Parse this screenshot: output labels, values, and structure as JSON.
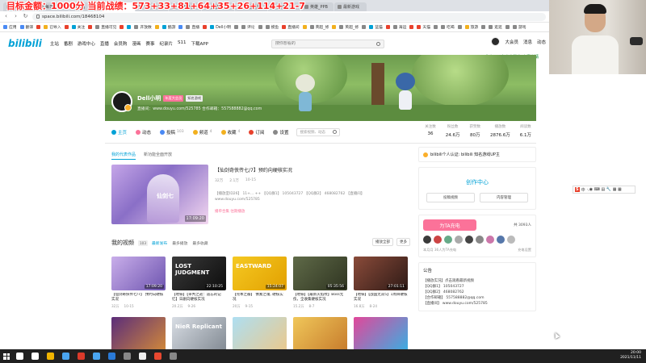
{
  "overlay": {
    "banner": "目标金额：1000分   当前战绩：573+33+81+64+35+26+114+21-7"
  },
  "tabs": [
    {
      "label": "全民超神",
      "active": false
    },
    {
      "label": "每日",
      "active": false
    },
    {
      "label": "B站",
      "active": false
    },
    {
      "label": "主页",
      "active": true
    },
    {
      "label": "创作中心",
      "active": false
    },
    {
      "label": "创作中心",
      "active": false
    },
    {
      "label": "蓝猫新闻",
      "active": false
    },
    {
      "label": "蓝猫新闻",
      "active": false
    },
    {
      "label": "多开",
      "active": false
    },
    {
      "label": "英雄_PPB",
      "active": false
    },
    {
      "label": "最新游戏",
      "active": false
    }
  ],
  "address": {
    "url": "space.bilibili.com/18468104"
  },
  "bookmarks": [
    {
      "label": "应用",
      "color": "#4a8af4"
    },
    {
      "label": "翻译",
      "color": "#4a8af4"
    },
    {
      "label": "",
      "color": "#e8412c"
    },
    {
      "label": "已导入",
      "color": "#f2b01e"
    },
    {
      "label": "",
      "color": "#e8412c"
    },
    {
      "label": "关注",
      "color": "#00a1d6"
    },
    {
      "label": "",
      "color": "#e8412c"
    },
    {
      "label": "直播可见",
      "color": "#888"
    },
    {
      "label": "",
      "color": "#e8412c"
    },
    {
      "label": "",
      "color": "#00a1d6"
    },
    {
      "label": "开放数",
      "color": "#888"
    },
    {
      "label": "",
      "color": "#f2b01e"
    },
    {
      "label": "酷游",
      "color": "#00a1d6"
    },
    {
      "label": "",
      "color": "#4a8af4"
    },
    {
      "label": "直播",
      "color": "#888"
    },
    {
      "label": "",
      "color": "#e8412c"
    },
    {
      "label": "Dell小明",
      "color": "#00a1d6"
    },
    {
      "label": "",
      "color": "#888"
    },
    {
      "label": "评论",
      "color": "#888"
    },
    {
      "label": "",
      "color": "#888"
    },
    {
      "label": "摸鱼",
      "color": "#888"
    },
    {
      "label": "直播间",
      "color": "#e8412c"
    },
    {
      "label": "",
      "color": "#f2b01e"
    },
    {
      "label": "英超_修",
      "color": "#888"
    },
    {
      "label": "",
      "color": "#f2b01e"
    },
    {
      "label": "英超_修",
      "color": "#888"
    },
    {
      "label": "",
      "color": "#888"
    },
    {
      "label": "蓝猫",
      "color": "#00a1d6"
    },
    {
      "label": "",
      "color": "#e8412c"
    },
    {
      "label": "海运",
      "color": "#888"
    },
    {
      "label": "",
      "color": "#e8412c"
    },
    {
      "label": "天猫",
      "color": "#e8412c"
    },
    {
      "label": "",
      "color": "#888"
    },
    {
      "label": "吃喝",
      "color": "#888"
    },
    {
      "label": "",
      "color": "#888"
    },
    {
      "label": "旅游",
      "color": "#f2b01e"
    },
    {
      "label": "",
      "color": "#888"
    },
    {
      "label": "逛逛",
      "color": "#888"
    },
    {
      "label": "",
      "color": "#888"
    },
    {
      "label": "游戏",
      "color": "#888"
    }
  ],
  "header": {
    "logo": "bilibili",
    "nav": [
      "主站",
      "番剧",
      "游戏中心",
      "直播",
      "会员购",
      "漫画",
      "赛事",
      "纪录片",
      "S11",
      "下载APP"
    ],
    "search_placeholder": "搜你想看的",
    "right": [
      "大会员",
      "消息",
      "动态"
    ]
  },
  "notice": "你有780条充电消息 查看详情",
  "profile": {
    "name": "Dell小明",
    "badge1": "年度大会员",
    "badge2": "知名游戏",
    "sign": "直播间：www.douyu.com/525785 合作邮箱：557588882@qq.com"
  },
  "page_nav": {
    "items": [
      {
        "label": "主页",
        "count": "",
        "active": true,
        "color": "#00a1d6"
      },
      {
        "label": "动态",
        "count": "",
        "active": false,
        "color": "#fb7299"
      },
      {
        "label": "投稿",
        "count": "103",
        "active": false,
        "color": "#4a8af4"
      },
      {
        "label": "频道",
        "count": "4",
        "active": false,
        "color": "#f2b01e"
      },
      {
        "label": "收藏",
        "count": "4",
        "active": false,
        "color": "#f2b01e"
      },
      {
        "label": "订阅",
        "count": "",
        "active": false,
        "color": "#e8412c"
      },
      {
        "label": "设置",
        "count": "",
        "active": false,
        "color": "#888"
      }
    ],
    "search_placeholder": "搜索视频、动态"
  },
  "stats": [
    {
      "label": "关注数",
      "value": "36"
    },
    {
      "label": "粉丝数",
      "value": "24.6万"
    },
    {
      "label": "获赞数",
      "value": "80万"
    },
    {
      "label": "播放数",
      "value": "2876.6万"
    },
    {
      "label": "阅读数",
      "value": "6.1万"
    }
  ],
  "representative": {
    "tabs": [
      {
        "label": "我的代表作品",
        "active": true
      },
      {
        "label": "新功能全面开放",
        "active": false
      }
    ],
    "title": "【仙剑奇侠传七/7】预约向硬核实况",
    "duration": "17:09:20",
    "meta": [
      "32万",
      "2.1万",
      "10-15"
    ],
    "desc": "【播放室ID26】 11+... ++ 【QQ群1】 105043727 【QQ群2】 468082762 【直播间】 www.douyu.com/525785",
    "links": "播单合集  往期播放"
  },
  "videos_header": {
    "title": "我的视频",
    "count": "103",
    "sorts": [
      {
        "label": "最新发布",
        "active": true
      },
      {
        "label": "最多播放",
        "active": false
      },
      {
        "label": "最多收藏",
        "active": false
      }
    ],
    "btn_play": "播放全部",
    "btn_more": "更多"
  },
  "videos": [
    {
      "title": "【仙剑奇侠传七/7】 预约向硬核实况",
      "duration": "17:09:20",
      "plays": "32万",
      "date": "10-15",
      "tt": "",
      "c1": "#c9aeea",
      "c2": "#6e55b0"
    },
    {
      "title": "【地铁】【审判之逝：遗忘的记忆】日剧向硬核实况",
      "duration": "22:10:25",
      "plays": "20.2万",
      "date": "9-26",
      "tt": "LOST JUDGMENT",
      "c1": "#3a3a3a",
      "c2": "#0d0d0d"
    },
    {
      "title": "【完本之瓣】 像素之魂, 硬核实况",
      "duration": "15:24:07",
      "plays": "20万",
      "date": "9-15",
      "tt": "EASTWARD",
      "c1": "#f5c922",
      "c2": "#e2a000"
    },
    {
      "title": "【地铁】【最新火焰纹】Boss无伤，全收集硬核实况",
      "duration": "05:35:56",
      "plays": "15.2万",
      "date": "8-7",
      "tt": "",
      "c1": "#5f6a48",
      "c2": "#2f3421"
    },
    {
      "title": "【地铁】【战国无双5】1周目硬核实况",
      "duration": "27:01:11",
      "plays": "16.8万",
      "date": "8-24",
      "tt": "",
      "c1": "#8a4b3a",
      "c2": "#2e1a16"
    },
    {
      "title": "",
      "duration": "",
      "plays": "",
      "date": "",
      "tt": "",
      "c1": "#5b2d7a",
      "c2": "#d1883a"
    },
    {
      "title": "",
      "duration": "",
      "plays": "",
      "date": "",
      "tt": "NieR Replicant",
      "c1": "#d8dde4",
      "c2": "#828a93"
    },
    {
      "title": "",
      "duration": "",
      "plays": "",
      "date": "",
      "tt": "",
      "c1": "#aedff2",
      "c2": "#eac98d"
    },
    {
      "title": "",
      "duration": "",
      "plays": "",
      "date": "",
      "tt": "",
      "c1": "#f0c75a",
      "c2": "#c77c2c"
    },
    {
      "title": "",
      "duration": "",
      "plays": "",
      "date": "",
      "tt": "",
      "c1": "#e2479a",
      "c2": "#3aaee2"
    }
  ],
  "right": {
    "cert": "bilibili个人认证: bilibili 知名游戏UP主",
    "creator_title": "创作中心",
    "creator_btns": [
      "投稿视频",
      "内容管理"
    ],
    "charge_btn": "为TA充电",
    "charge_count": "共 3093人",
    "charge_foot_left": "本月月 36人为TA充电",
    "charge_foot_right": "充电设置",
    "charge_avatar_colors": [
      "#3b3b3b",
      "#c44",
      "#6a8",
      "#aaa",
      "#444",
      "#888",
      "#c7a",
      "#5577aa",
      "#bbb"
    ],
    "ann_title": "公告",
    "ann_lines": [
      "【播放实况】点击观看最新视频",
      "【QQ群1】 105043727",
      "【QQ群2】 468082762",
      "【合作邮箱】 557588882@qq.com",
      "【直播间】 www.douyu.com/525785"
    ]
  },
  "ime": {
    "label": "中",
    "items": "·,◉ ⌨ ▤ 🔧 ▦ ▦"
  },
  "taskbar": {
    "time": "20:00",
    "date": "2021/11/11",
    "icon_colors": [
      "#fff",
      "#fff",
      "#f0b400",
      "#4aa5f0",
      "#db3a2a",
      "#4aa5f0",
      "#2a7ad6",
      "#888",
      "#eee",
      "#e84830",
      "#888"
    ]
  }
}
